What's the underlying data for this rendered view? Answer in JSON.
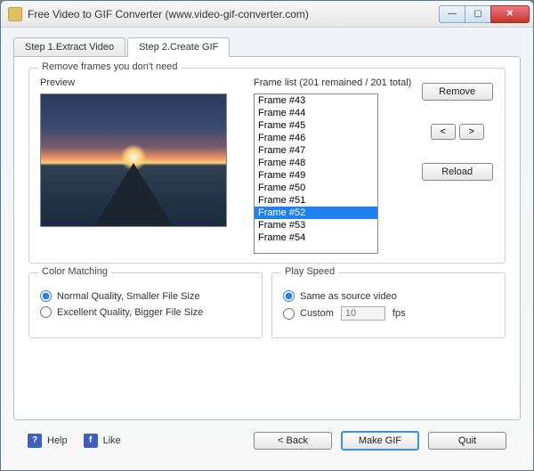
{
  "titlebar": {
    "title": "Free Video to GIF Converter (www.video-gif-converter.com)"
  },
  "tabs": [
    {
      "label": "Step 1.Extract Video",
      "active": false
    },
    {
      "label": "Step 2.Create GIF",
      "active": true
    }
  ],
  "frames_group": {
    "label": "Remove frames you don't need",
    "preview_label": "Preview",
    "list_label": "Frame list (201 remained / 201 total)",
    "remained": 201,
    "total": 201,
    "items": [
      "Frame #43",
      "Frame #44",
      "Frame #45",
      "Frame #46",
      "Frame #47",
      "Frame #48",
      "Frame #49",
      "Frame #50",
      "Frame #51",
      "Frame #52",
      "Frame #53",
      "Frame #54"
    ],
    "selected_index": 9,
    "remove_label": "Remove",
    "prev_label": "<",
    "next_label": ">",
    "reload_label": "Reload"
  },
  "color_matching": {
    "label": "Color Matching",
    "options": [
      {
        "label": "Normal Quality, Smaller File Size",
        "checked": true
      },
      {
        "label": "Excellent Quality, Bigger File Size",
        "checked": false
      }
    ]
  },
  "play_speed": {
    "label": "Play Speed",
    "options": [
      {
        "label": "Same as source video",
        "checked": true
      },
      {
        "label": "Custom",
        "checked": false
      }
    ],
    "custom_value": "10",
    "unit": "fps"
  },
  "footer": {
    "help_label": "Help",
    "like_label": "Like",
    "back_label": "< Back",
    "make_label": "Make GIF",
    "quit_label": "Quit"
  }
}
